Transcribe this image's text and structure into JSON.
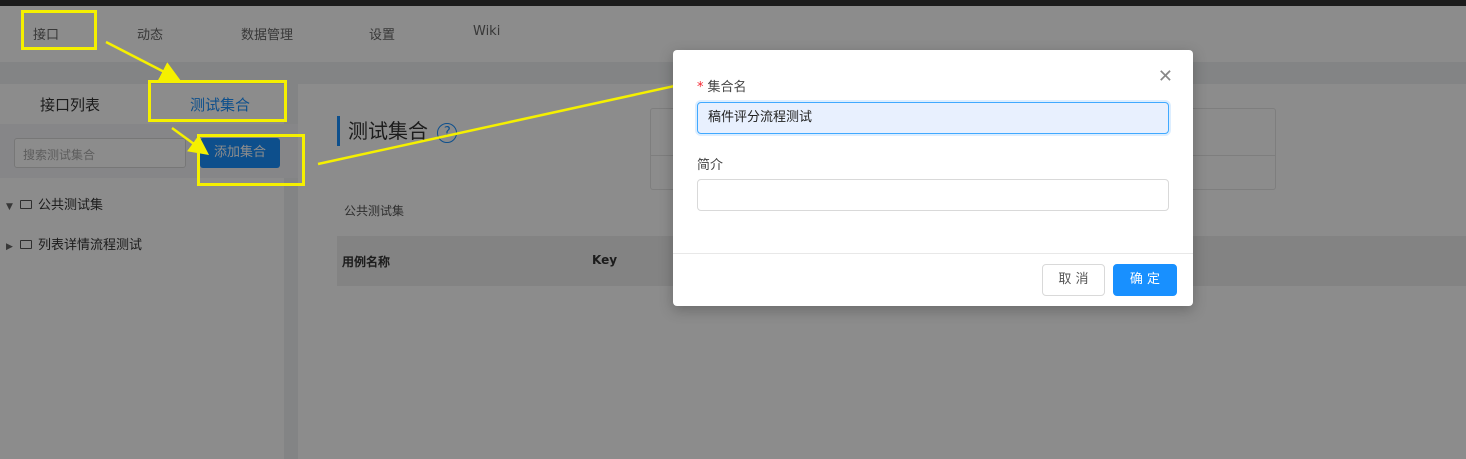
{
  "nav": {
    "items": [
      "接口",
      "动态",
      "数据管理",
      "设置",
      "Wiki"
    ]
  },
  "sidebar": {
    "tabs": [
      "接口列表",
      "测试集合"
    ],
    "search_placeholder": "搜索测试集合",
    "add_button": "添加集合",
    "tree": [
      {
        "label": "公共测试集",
        "caret": "▼"
      },
      {
        "label": "列表详情流程测试",
        "caret": "▶"
      }
    ]
  },
  "main": {
    "title": "测试集合",
    "help_glyph": "?",
    "subtitle": "公共测试集",
    "columns": [
      "用例名称",
      "Key"
    ]
  },
  "modal": {
    "close_glyph": "✕",
    "name_label": "集合名",
    "required_mark": "*",
    "name_value": "稿件评分流程测试",
    "desc_label": "简介",
    "desc_value": "",
    "cancel_label": "取 消",
    "ok_label": "确 定"
  },
  "colors": {
    "primary": "#1890ff",
    "annotation": "#f5f000",
    "mask": "rgba(0,0,0,0.45)"
  }
}
